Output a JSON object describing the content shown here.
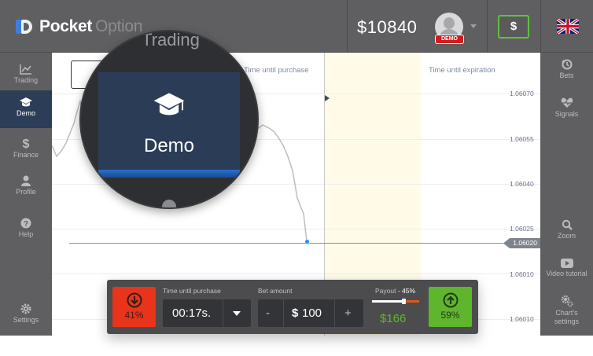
{
  "header": {
    "logo_bold": "Pocket",
    "logo_light": "Option",
    "balance": "$10840",
    "demo_badge": "DEMO",
    "currency_button": "$"
  },
  "left_nav": {
    "items": [
      {
        "label": "Trading",
        "icon": "trend-chart-icon",
        "active": false
      },
      {
        "label": "Demo",
        "icon": "graduation-cap-icon",
        "active": true
      },
      {
        "label": "Finance",
        "icon": "dollar-icon",
        "active": false
      },
      {
        "label": "Profile",
        "icon": "user-icon",
        "active": false
      },
      {
        "label": "Help",
        "icon": "question-icon",
        "active": false
      },
      {
        "label": "Settings",
        "icon": "gear-icon",
        "active": false
      }
    ]
  },
  "right_nav": {
    "items": [
      {
        "label": "Bets",
        "icon": "history-icon"
      },
      {
        "label": "Signals",
        "icon": "heart-pulse-icon"
      },
      {
        "label": "Zoom",
        "icon": "magnifier-icon"
      },
      {
        "label": "Video tutorial",
        "icon": "video-icon"
      },
      {
        "label": "Chart's settings",
        "icon": "gears-icon"
      }
    ]
  },
  "chart": {
    "time_until_purchase_label": "Time until purchase",
    "time_until_expiration_label": "Time until expiration",
    "price_ticks": [
      "1.06070",
      "1.06055",
      "1.06040",
      "1.06025",
      "1.06010",
      "1.06010"
    ],
    "current_price": "1.06020"
  },
  "magnifier": {
    "top_text": "Trading",
    "label": "Demo"
  },
  "trade_panel": {
    "down_percent": "41%",
    "up_percent": "59%",
    "time_label": "Time until purchase",
    "time_value": "00:17s.",
    "bet_label": "Bet amount",
    "bet_currency": "$",
    "bet_value": "100",
    "minus": "-",
    "plus": "+",
    "payout_label": "Payout",
    "payout_percent": "- 45%",
    "payout_level": 0.66,
    "payout_value": "$166",
    "colors": {
      "down": "#e8341b",
      "up": "#5fb52e"
    }
  }
}
